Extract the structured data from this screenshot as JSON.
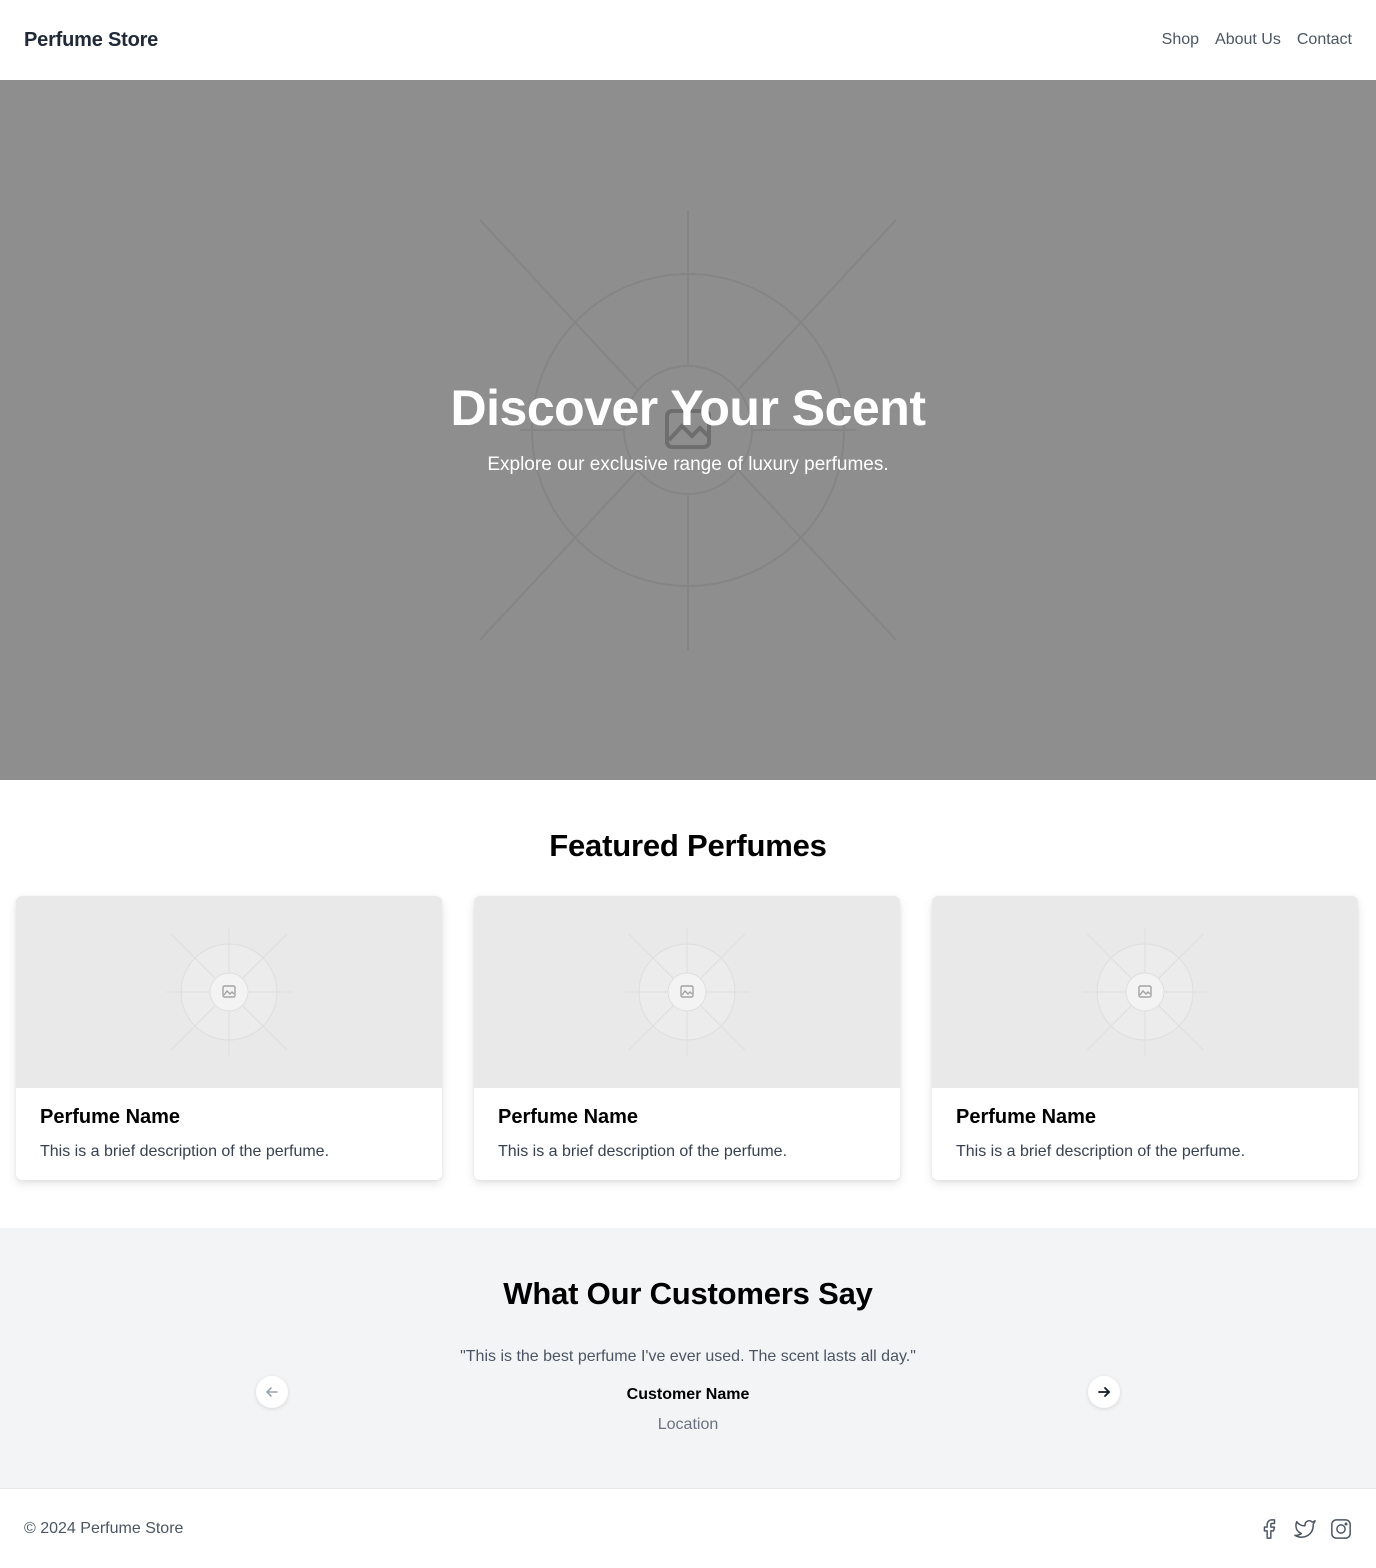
{
  "header": {
    "brand": "Perfume Store",
    "nav": [
      "Shop",
      "About Us",
      "Contact"
    ]
  },
  "hero": {
    "title": "Discover Your Scent",
    "subtitle": "Explore our exclusive range of luxury perfumes."
  },
  "featured": {
    "title": "Featured Perfumes",
    "cards": [
      {
        "name": "Perfume Name",
        "description": "This is a brief description of the perfume."
      },
      {
        "name": "Perfume Name",
        "description": "This is a brief description of the perfume."
      },
      {
        "name": "Perfume Name",
        "description": "This is a brief description of the perfume."
      }
    ]
  },
  "testimonials": {
    "title": "What Our Customers Say",
    "quote": "\"This is the best perfume I've ever used. The scent lasts all day.\"",
    "customer_name": "Customer Name",
    "location": "Location",
    "prev_icon": "arrow-left-icon",
    "next_icon": "arrow-right-icon"
  },
  "footer": {
    "copyright": "© 2024 Perfume Store",
    "social_icons": [
      "facebook-icon",
      "twitter-icon",
      "instagram-icon"
    ]
  },
  "colors": {
    "hero_bg": "#8e8e8e",
    "card_image_bg": "#e9e9e9",
    "testimonials_bg": "#f3f4f6",
    "text_muted": "#4b5563"
  }
}
